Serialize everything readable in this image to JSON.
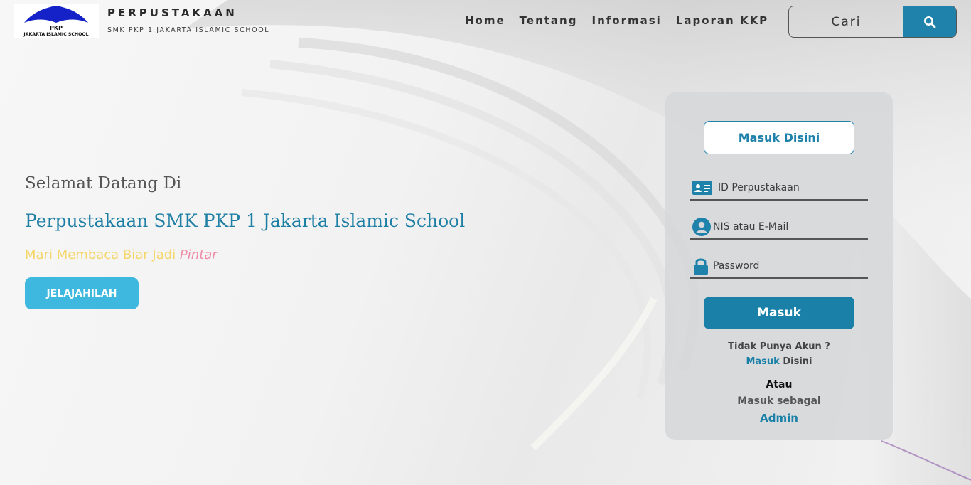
{
  "header": {
    "brand_title": "PERPUSTAKAAN",
    "brand_subtitle": "SMK PKP 1 JAKARTA ISLAMIC SCHOOL",
    "logo_text_top": "PKP",
    "logo_text_bottom": "JAKARTA ISLAMIC SCHOOL",
    "nav": [
      "Home",
      "Tentang",
      "Informasi",
      "Laporan KKP"
    ],
    "search": {
      "placeholder": "Cari",
      "icon": "search-icon"
    }
  },
  "hero": {
    "welcome": "Selamat Datang Di",
    "title": "Perpustakaan SMK PKP 1 Jakarta Islamic School",
    "tagline_main": "Mari Membaca Biar Jadi ",
    "tagline_accent": "Pintar",
    "cta_label": "JELAJAHILAH"
  },
  "login": {
    "header_button": "Masuk Disini",
    "fields": {
      "library_id": {
        "placeholder": "ID Perpustakaan",
        "icon": "id-card-icon"
      },
      "nis_email": {
        "placeholder": "NIS atau E-Mail",
        "icon": "user-icon"
      },
      "password": {
        "placeholder": "Password",
        "icon": "lock-icon"
      }
    },
    "submit_label": "Masuk",
    "no_account_text": "Tidak Punya Akun ?",
    "register_link": "Masuk",
    "register_suffix": " Disini",
    "or_text": "Atau",
    "login_as_text": "Masuk sebagai",
    "admin_link": "Admin"
  },
  "colors": {
    "primary": "#1f82ab",
    "cta": "#3fb8df",
    "tagline_yellow": "#f5d66b",
    "tagline_pink": "#ef8aa6"
  }
}
